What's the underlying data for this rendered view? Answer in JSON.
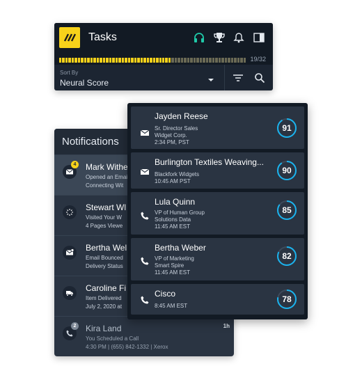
{
  "tasks": {
    "title": "Tasks",
    "progress_count": "19/32",
    "progress_fraction": 0.594,
    "sort_label": "Sort By",
    "sort_value": "Neural Score",
    "icons": [
      "headset-icon",
      "trophy-icon",
      "bell-icon",
      "sidebar-panel-icon",
      "filter-icon",
      "search-icon"
    ],
    "colors": {
      "brand": "#f7d21a",
      "progress_fill": "#f7d21a",
      "progress_empty": "#6b6a55",
      "headset": "#1fc9a8"
    }
  },
  "notifications": {
    "title": "Notifications",
    "items": [
      {
        "icon": "mail-icon",
        "badge": "4",
        "name": "Mark Withe",
        "line1": "Opened an Emai",
        "line2": "Connecting Wit",
        "time": "",
        "active": true
      },
      {
        "icon": "click-icon",
        "badge": "",
        "name": "Stewart Wl",
        "line1": "Visited Your W",
        "line2": "4 Pages Viewe",
        "time": "",
        "active": false
      },
      {
        "icon": "mail-alert-icon",
        "badge": "",
        "name": "Bertha Wel",
        "line1": "Email Bounced",
        "line2": "Delivery Status",
        "time": "",
        "active": false
      },
      {
        "icon": "delivery-truck-icon",
        "badge": "",
        "name": "Caroline Fi",
        "line1": "Item Delivered",
        "line2": "July 2, 2020 at",
        "time": "",
        "active": false
      },
      {
        "icon": "phone-icon",
        "badge": "2",
        "name": "Kira Land",
        "line1": "You Scheduled a Call",
        "line2": "4:30 PM | (655) 842-1332 | Xerox",
        "time": "1h",
        "active": false,
        "muted": true
      }
    ]
  },
  "cards": {
    "items": [
      {
        "icon": "mail-icon",
        "name": "Jayden Reese",
        "lines": [
          "Sr. Director Sales",
          "Widget Corp.",
          "2:34 PM, PST"
        ],
        "score": 91
      },
      {
        "icon": "mail-icon",
        "name": "Burlington Textiles Weaving...",
        "lines": [
          "Blackfork Widgets",
          "10:45 AM PST"
        ],
        "score": 90
      },
      {
        "icon": "phone-icon",
        "name": "Lula Quinn",
        "lines": [
          "VP of Human Group",
          "Solutions Data",
          "11:45 AM EST"
        ],
        "score": 85
      },
      {
        "icon": "phone-icon",
        "name": "Bertha Weber",
        "lines": [
          "VP of Marketing",
          "Smart Spire",
          "11:45 AM EST"
        ],
        "score": 82
      },
      {
        "icon": "phone-icon",
        "name": "Cisco",
        "lines": [
          "8:45 AM EST"
        ],
        "score": 78
      }
    ],
    "colors": {
      "score_ring": "#1ab3ee",
      "score_track": "#3d4a5a"
    }
  }
}
